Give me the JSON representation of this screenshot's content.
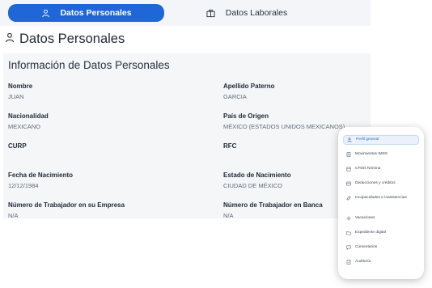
{
  "tabs": {
    "personal": {
      "label": "Datos Personales",
      "icon": "person-icon"
    },
    "laboral": {
      "label": "Datos Laborales",
      "icon": "briefcase-icon"
    }
  },
  "page": {
    "title": "Datos Personales",
    "icon": "person-icon"
  },
  "card": {
    "title": "Información de Datos Personales"
  },
  "fields": {
    "nombre": {
      "label": "Nombre",
      "value": "JUAN"
    },
    "apellido": {
      "label": "Apellido Paterno",
      "value": "GARCIA"
    },
    "nacionalidad": {
      "label": "Nacionalidad",
      "value": "MEXICANO"
    },
    "pais": {
      "label": "País de Origen",
      "value": "MÉXICO (ESTADOS UNIDOS MEXICANOS)"
    },
    "curp": {
      "label": "CURP",
      "value": ""
    },
    "rfc": {
      "label": "RFC",
      "value": ""
    },
    "fecha": {
      "label": "Fecha de Nacimiento",
      "value": "12/12/1984"
    },
    "estado": {
      "label": "Estado de Nacimiento",
      "value": "CIUDAD DE MÉXICO"
    },
    "trabajador_empresa": {
      "label": "Número de Trabajador en su Empresa",
      "value": "N/A"
    },
    "trabajador_banca": {
      "label": "Número de Trabajador en Banca",
      "value": "N/A"
    }
  },
  "menu": {
    "items": [
      {
        "label": "Perfil general",
        "icon": "person-icon",
        "active": true
      },
      {
        "label": "Movimientos IMSS",
        "icon": "document-icon",
        "active": false
      },
      {
        "label": "CFDIs Nómina",
        "icon": "receipt-icon",
        "active": false
      },
      {
        "label": "Deducciones y créditos",
        "icon": "list-icon",
        "active": false
      },
      {
        "label": "Incapacidades e inasistencias",
        "icon": "bandage-icon",
        "active": false
      },
      {
        "label": "Vacaciones",
        "icon": "sun-icon",
        "active": false
      },
      {
        "label": "Expediente digital",
        "icon": "folder-icon",
        "active": false
      },
      {
        "label": "Comentarios",
        "icon": "comment-icon",
        "active": false
      },
      {
        "label": "Auditoría",
        "icon": "audit-icon",
        "active": false
      }
    ]
  },
  "colors": {
    "accent": "#1f67d8",
    "card_bg": "#f5f6f8",
    "tabbar_bg": "#f3f5f8"
  }
}
